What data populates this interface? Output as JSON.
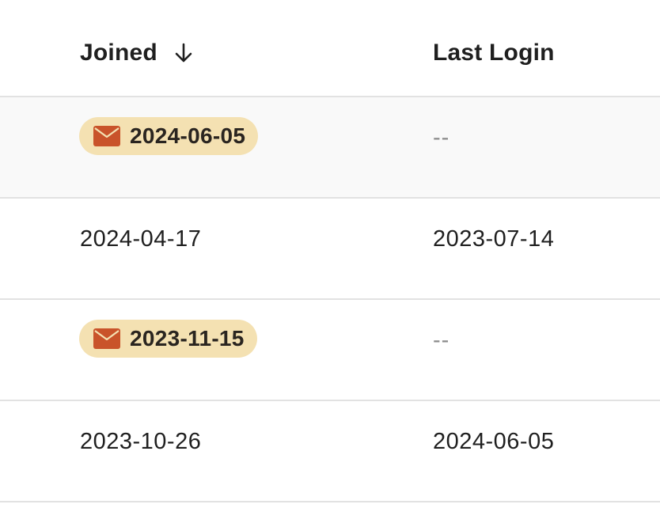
{
  "columns": {
    "joined": {
      "label": "Joined",
      "sort": "descending",
      "sort_icon": "arrow-down-icon"
    },
    "last_login": {
      "label": "Last Login"
    }
  },
  "rows": [
    {
      "joined": "2024-06-05",
      "joined_pending_invite": true,
      "last_login": "--"
    },
    {
      "joined": "2024-04-17",
      "joined_pending_invite": false,
      "last_login": "2023-07-14"
    },
    {
      "joined": "2023-11-15",
      "joined_pending_invite": true,
      "last_login": "--"
    },
    {
      "joined": "2023-10-26",
      "joined_pending_invite": false,
      "last_login": "2024-06-05"
    }
  ],
  "colors": {
    "pill_background": "#f4e1b2",
    "mail_icon": "#c9532a",
    "row_highlight": "#f9f9f9",
    "divider": "#e2e2e2",
    "placeholder_text": "#8a8a8a"
  },
  "icons": {
    "pending_invite": "mail-icon"
  }
}
